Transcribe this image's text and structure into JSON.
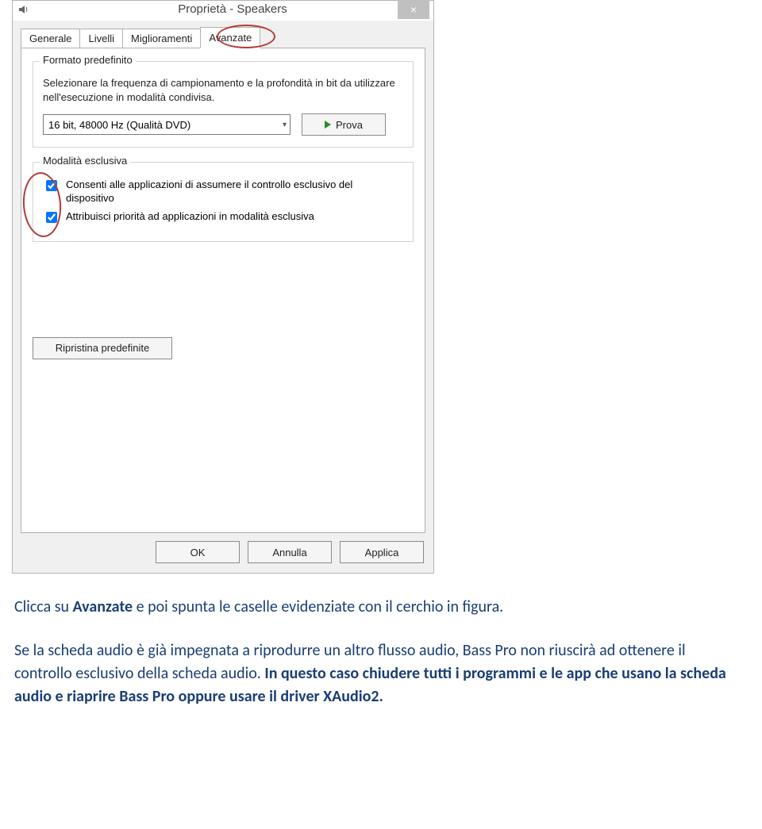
{
  "dialog": {
    "title": "Proprietà - Speakers",
    "close_label": "×",
    "tabs": {
      "t0": "Generale",
      "t1": "Livelli",
      "t2": "Miglioramenti",
      "t3": "Avanzate"
    },
    "group_format": {
      "legend": "Formato predefinito",
      "desc": "Selezionare la frequenza di campionamento e la profondità in bit da utilizzare nell'esecuzione in modalità condivisa.",
      "combo_value": "16 bit, 48000 Hz (Qualità DVD)",
      "test_label": "Prova"
    },
    "group_exclusive": {
      "legend": "Modalità esclusiva",
      "check1": "Consenti alle applicazioni di assumere il controllo esclusivo del dispositivo",
      "check2": "Attribuisci priorità ad applicazioni in modalità esclusiva"
    },
    "restore_label": "Ripristina predefinite",
    "buttons": {
      "ok": "OK",
      "cancel": "Annulla",
      "apply": "Applica"
    }
  },
  "article": {
    "p1_a": "Clicca su ",
    "p1_b": "Avanzate",
    "p1_c": " e poi spunta le caselle evidenziate con il cerchio in figura.",
    "p2_a": "Se la scheda audio è già impegnata a riprodurre un altro flusso audio, Bass Pro non riuscirà ad ottenere il controllo esclusivo della scheda audio. ",
    "p2_b": "In questo caso chiudere tutti i programmi e le app che usano la scheda audio e riaprire Bass Pro oppure usare il driver XAudio2."
  }
}
